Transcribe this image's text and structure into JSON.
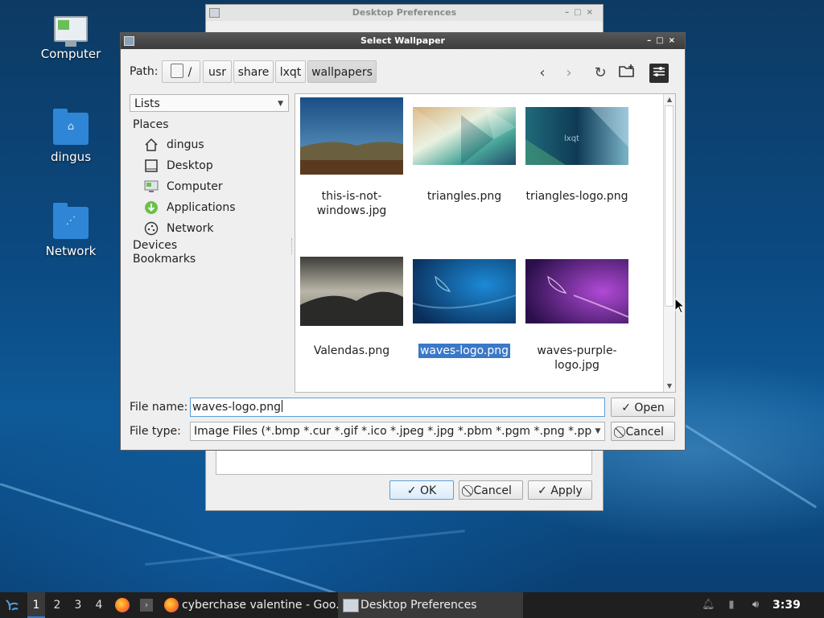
{
  "desktop": {
    "icons": [
      {
        "label": "Computer"
      },
      {
        "label": "dingus"
      },
      {
        "label": "Network"
      }
    ]
  },
  "back_window": {
    "title": "Desktop Preferences",
    "buttons": {
      "ok": "✓ OK",
      "cancel": "⃠ Cancel",
      "apply": "✓ Apply"
    }
  },
  "dialog": {
    "title": "Select Wallpaper",
    "path_label": "Path:",
    "crumbs": [
      "/",
      "usr",
      "share",
      "lxqt",
      "wallpapers"
    ],
    "view_mode": "Lists",
    "places": {
      "heading": "Places",
      "items": [
        "dingus",
        "Desktop",
        "Computer",
        "Applications",
        "Network"
      ],
      "devices": "Devices",
      "bookmarks": "Bookmarks"
    },
    "files": [
      {
        "name": "this-is-not-windows.jpg",
        "line1": "this-is-not-",
        "line2": "windows.jpg",
        "selected": false
      },
      {
        "name": "triangles.png",
        "line1": "triangles.png",
        "line2": "",
        "selected": false
      },
      {
        "name": "triangles-logo.png",
        "line1": "triangles-logo.png",
        "line2": "",
        "selected": false
      },
      {
        "name": "Valendas.png",
        "line1": "Valendas.png",
        "line2": "",
        "selected": false
      },
      {
        "name": "waves-logo.png",
        "line1": "waves-logo.png",
        "line2": "",
        "selected": true
      },
      {
        "name": "waves-purple-logo.jpg",
        "line1": "waves-purple-",
        "line2": "logo.jpg",
        "selected": false
      }
    ],
    "filename_label": "File name:",
    "filename_value": "waves-logo.png",
    "filetype_label": "File type:",
    "filetype_value": "Image Files (*.bmp *.cur *.gif *.ico *.jpeg *.jpg *.pbm *.pgm *.png *.ppm *.svg",
    "open_label": "Open",
    "cancel_label": "Cancel"
  },
  "taskbar": {
    "desktops": [
      "1",
      "2",
      "3",
      "4"
    ],
    "active_desktop": "1",
    "tasks": [
      {
        "label": "cyberchase valentine - Goo..."
      },
      {
        "label": "Desktop Preferences"
      }
    ],
    "clock": "3:39"
  },
  "colors": {
    "selection": "#3a78c8",
    "focus_border": "#5a9fd8"
  }
}
